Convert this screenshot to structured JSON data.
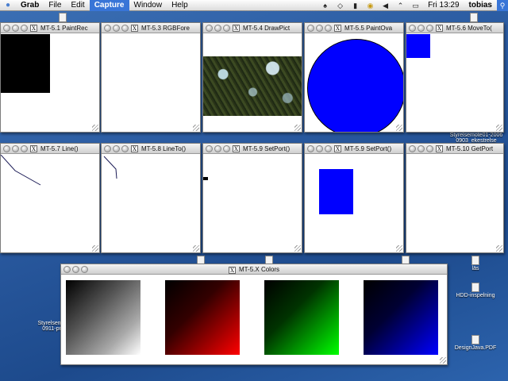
{
  "menubar": {
    "app_name": "Grab",
    "items": [
      "File",
      "Edit",
      "Capture",
      "Window",
      "Help"
    ],
    "active_item": "Capture",
    "clock": "Fri 13:29",
    "user": "tobias"
  },
  "windows": {
    "w1": "MT-5.1 PaintRec",
    "w2": "MT-5.3 RGBFore",
    "w3": "MT-5.4 DrawPict",
    "w4": "MT-5.5 PaintOva",
    "w5": "MT-5.6 MoveTo(",
    "w6": "MT-5.7 Line()",
    "w7": "MT-5.8 LineTo()",
    "w8": "MT-5.9 SetPort()",
    "w9": "MT-5.9 SetPort()",
    "w10": "MT-5.10 GetPort",
    "colors": "MT-5.X Colors"
  },
  "desktop": {
    "icon_styrelse_top_1": "Styrelsemote01-2006",
    "icon_styrelse_top_2": "0903_ekestrelse",
    "icon_styrelse_left_1": "Styrelsemo",
    "icon_styrelse_left_2": "0911-pr",
    "icon_las": "läs",
    "icon_hdd": "HDD-inspelning",
    "icon_design": "DesignJava.PDF"
  },
  "colors": {
    "fill_blue": "#0000ff",
    "fill_black": "#000000",
    "gradients": [
      "gray",
      "red",
      "green",
      "blue"
    ]
  }
}
